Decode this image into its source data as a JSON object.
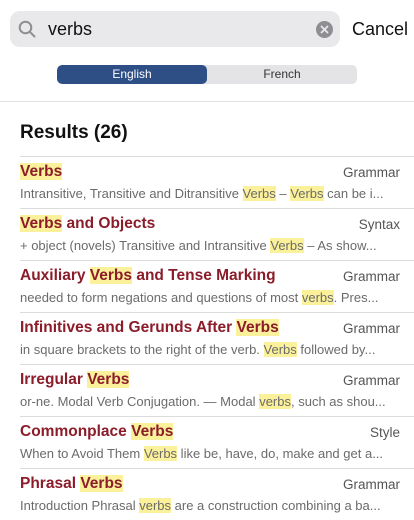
{
  "search": {
    "value": "verbs",
    "cancel_label": "Cancel"
  },
  "language_toggle": {
    "options": [
      "English",
      "French"
    ],
    "selected": "English"
  },
  "results": {
    "heading": "Results (26)",
    "items": [
      {
        "title": [
          {
            "t": "Verbs",
            "hl": true
          }
        ],
        "category": "Grammar",
        "snippet": [
          {
            "t": "Intransitive, Transitive and Ditransitive "
          },
          {
            "t": "Verbs",
            "hl": true
          },
          {
            "t": " – "
          },
          {
            "t": "Verbs",
            "hl": true
          },
          {
            "t": " can be i..."
          }
        ]
      },
      {
        "title": [
          {
            "t": "Verbs",
            "hl": true
          },
          {
            "t": " and Objects"
          }
        ],
        "category": "Syntax",
        "snippet": [
          {
            "t": "+ object (novels) Transitive and Intransitive "
          },
          {
            "t": "Verbs",
            "hl": true
          },
          {
            "t": " – As show..."
          }
        ]
      },
      {
        "title": [
          {
            "t": "Auxiliary "
          },
          {
            "t": "Verbs",
            "hl": true
          },
          {
            "t": " and Tense Marking"
          }
        ],
        "category": "Grammar",
        "snippet": [
          {
            "t": "needed to form negations and questions of most "
          },
          {
            "t": "verbs",
            "hl": true
          },
          {
            "t": ". Pres..."
          }
        ]
      },
      {
        "title": [
          {
            "t": "Infinitives and Gerunds After "
          },
          {
            "t": "Verbs",
            "hl": true
          }
        ],
        "category": "Grammar",
        "snippet": [
          {
            "t": "in square brackets to the right of the verb. "
          },
          {
            "t": "Verbs",
            "hl": true
          },
          {
            "t": " followed by..."
          }
        ]
      },
      {
        "title": [
          {
            "t": "Irregular "
          },
          {
            "t": "Verbs",
            "hl": true
          }
        ],
        "category": "Grammar",
        "snippet": [
          {
            "t": "or-ne. Modal Verb Conjugation. — Modal "
          },
          {
            "t": "verbs",
            "hl": true
          },
          {
            "t": ", such as shou..."
          }
        ]
      },
      {
        "title": [
          {
            "t": "Commonplace "
          },
          {
            "t": "Verbs",
            "hl": true
          }
        ],
        "category": "Style",
        "snippet": [
          {
            "t": "When to Avoid Them "
          },
          {
            "t": "Verbs",
            "hl": true
          },
          {
            "t": " like be, have, do, make and get a..."
          }
        ]
      },
      {
        "title": [
          {
            "t": "Phrasal "
          },
          {
            "t": "Verbs",
            "hl": true
          }
        ],
        "category": "Grammar",
        "snippet": [
          {
            "t": "Introduction Phrasal "
          },
          {
            "t": "verbs",
            "hl": true
          },
          {
            "t": " are a construction combining a ba..."
          }
        ]
      }
    ]
  },
  "colors": {
    "title_red": "#8b1c2a",
    "highlight": "#fcf19b",
    "segment_active": "#2e4e86"
  },
  "icons": {
    "search": "magnifier",
    "clear": "x-circle"
  }
}
